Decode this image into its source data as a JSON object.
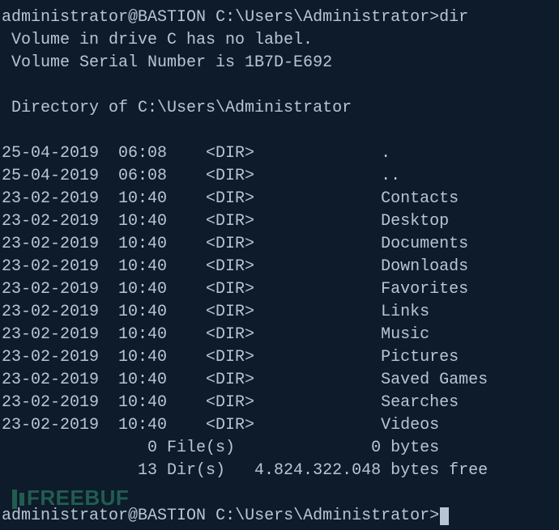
{
  "prompt": {
    "user_host": "administrator@BASTION",
    "path": "C:\\Users\\Administrator",
    "sep": ">"
  },
  "command": "dir",
  "header": {
    "volume_line": " Volume in drive C has no label.",
    "serial_line": " Volume Serial Number is 1B7D-E692",
    "dir_line": " Directory of C:\\Users\\Administrator"
  },
  "entries": [
    {
      "date": "25-04-2019",
      "time": "06:08",
      "type": "<DIR>",
      "name": "."
    },
    {
      "date": "25-04-2019",
      "time": "06:08",
      "type": "<DIR>",
      "name": ".."
    },
    {
      "date": "23-02-2019",
      "time": "10:40",
      "type": "<DIR>",
      "name": "Contacts"
    },
    {
      "date": "23-02-2019",
      "time": "10:40",
      "type": "<DIR>",
      "name": "Desktop"
    },
    {
      "date": "23-02-2019",
      "time": "10:40",
      "type": "<DIR>",
      "name": "Documents"
    },
    {
      "date": "23-02-2019",
      "time": "10:40",
      "type": "<DIR>",
      "name": "Downloads"
    },
    {
      "date": "23-02-2019",
      "time": "10:40",
      "type": "<DIR>",
      "name": "Favorites"
    },
    {
      "date": "23-02-2019",
      "time": "10:40",
      "type": "<DIR>",
      "name": "Links"
    },
    {
      "date": "23-02-2019",
      "time": "10:40",
      "type": "<DIR>",
      "name": "Music"
    },
    {
      "date": "23-02-2019",
      "time": "10:40",
      "type": "<DIR>",
      "name": "Pictures"
    },
    {
      "date": "23-02-2019",
      "time": "10:40",
      "type": "<DIR>",
      "name": "Saved Games"
    },
    {
      "date": "23-02-2019",
      "time": "10:40",
      "type": "<DIR>",
      "name": "Searches"
    },
    {
      "date": "23-02-2019",
      "time": "10:40",
      "type": "<DIR>",
      "name": "Videos"
    }
  ],
  "summary": {
    "files_line": "               0 File(s)              0 bytes",
    "dirs_line": "              13 Dir(s)   4.824.322.048 bytes free"
  },
  "watermark": "FREEBUF"
}
